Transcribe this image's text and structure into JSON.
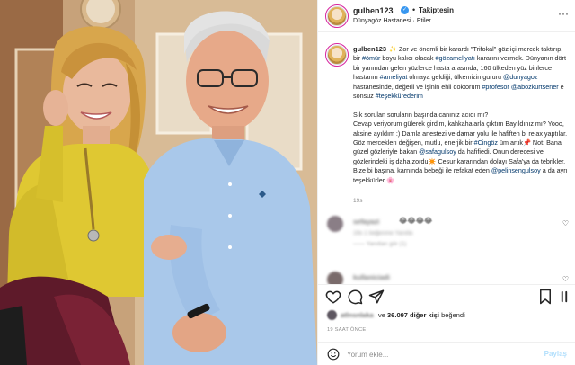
{
  "post": {
    "username": "gulben123",
    "verified_icon": "verified-badge-icon",
    "follow_label": "Takiptesin",
    "location": "Dünyagöz Hastanesi · Etiler"
  },
  "caption": {
    "username": "gulben123",
    "p1": "✨ Zor ve önemli bir karardı \"Trifokal\" göz içi mercek taktırıp, bir ",
    "p2": " boyu kalıcı olacak ",
    "p3": " kararını vermek. Dünyanın dört bir yanından gelen yüzlerce hasta arasında, 160 ülkeden yüz binlerce hastanın ",
    "p4": " olmaya geldiği, ülkemizin gururu ",
    "p5": " hastanesinde, değerli ve işinin ehli doktorum ",
    "p6": " e sonsuz ",
    "p7": "\nSık sorulan soruların başında canınız acıdı mı?\nCevap veriyorum gülerek girdim, kahkahalarla çıktım Bayıldınız mı? Yooo, aksine ayıldım :) Damla anestezi ve damar yolu ile hafiften bi relax yaptılar.\nGöz merceklerı değişen, mutlu, enerjik bir ",
    "p8": " üm artık",
    "p9": " Not: Bana güzel gözleriyle bakan ",
    "p10": " da hafifiedi. Onun derecesi ve gözlerindeki iş daha zordu",
    "p11": " Cesur kararından dolayı Safa'ya da tebrikler. Bize bi başına. karnında bebeği ile refakat eden ",
    "p12": " a da ayrı teşekkürler ",
    "tag_omur": "#ömür",
    "tag_gozameliyati": "#gözameliyatı",
    "tag_ameliyat": "#ameliyat",
    "tag_dunyagoz": "@dunyagoz",
    "tag_profesor": "#profesör",
    "tag_abozkurtsener": "@abozkurtsener",
    "tag_tesekkurederim": "#teşekkürederim",
    "tag_cingoz": "#Cingöz",
    "tag_safagulsoy": "@safagulsoy",
    "tag_pelinsengulsoy": "@pelinsengulsoy",
    "emoji_pin": "📌",
    "emoji_star": "✴️",
    "emoji_flower": "🌸",
    "time": "19s"
  },
  "comments": [
    {
      "username": "sefayazi",
      "body": "😂😂😂😂",
      "meta": "19s   1 beğenme   Yanıtla",
      "replies": "—— Yanıtları gör (1)"
    },
    {
      "username": "kullaniciadi",
      "body": "",
      "meta": "",
      "replies": ""
    }
  ],
  "likes": {
    "liked_by": "atlnsnlaka",
    "connector": "ve",
    "count_text": "36.097 diğer kişi",
    "suffix": "beğendi"
  },
  "time_ago": "19 SAAT ÖNCE",
  "comment_box": {
    "placeholder": "Yorum ekle...",
    "share_label": "Paylaş"
  },
  "colors": {
    "accent_link": "#00376b",
    "share_disabled": "#b2dffc",
    "verified": "#3897f0",
    "story_ring": "#d6249f"
  }
}
